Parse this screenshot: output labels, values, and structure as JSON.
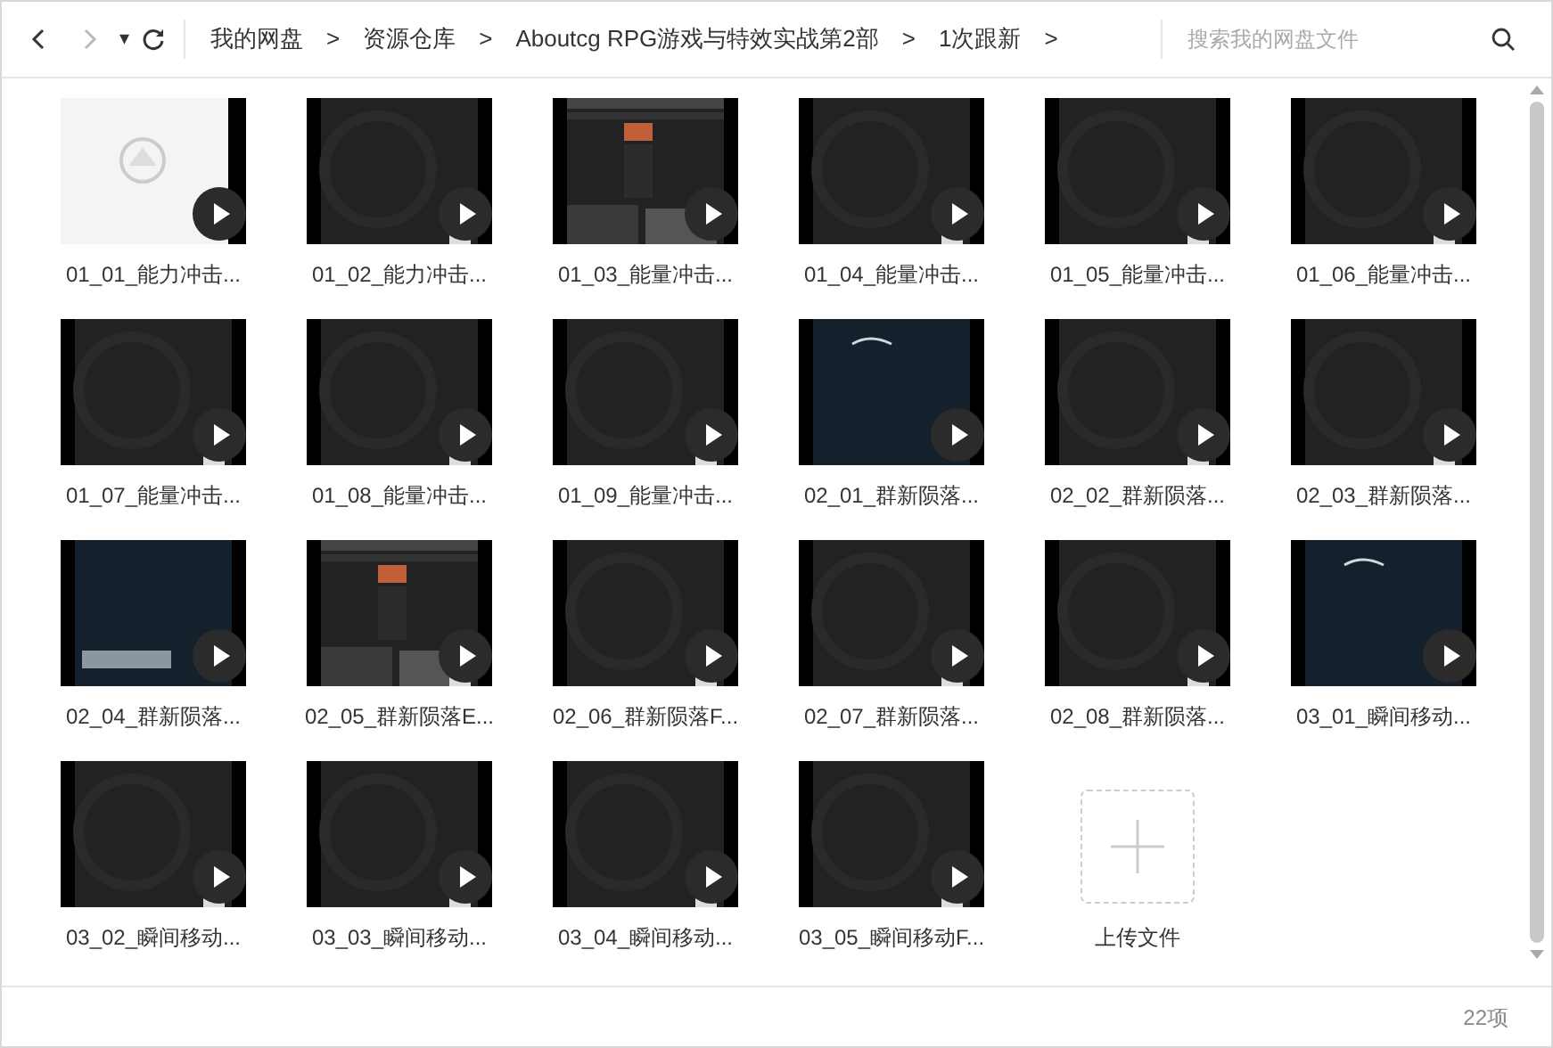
{
  "toolbar": {
    "dropdown": "▾",
    "breadcrumbs": [
      {
        "label": "我的网盘"
      },
      {
        "label": "资源仓库"
      },
      {
        "label": "Aboutcg RPG游戏与特效实战第2部"
      },
      {
        "label": "1次跟新"
      }
    ],
    "separator": ">",
    "search": {
      "placeholder": "搜索我的网盘文件"
    }
  },
  "files": [
    {
      "name": "01_01_能力冲击..."
    },
    {
      "name": "01_02_能力冲击..."
    },
    {
      "name": "01_03_能量冲击..."
    },
    {
      "name": "01_04_能量冲击..."
    },
    {
      "name": "01_05_能量冲击..."
    },
    {
      "name": "01_06_能量冲击..."
    },
    {
      "name": "01_07_能量冲击..."
    },
    {
      "name": "01_08_能量冲击..."
    },
    {
      "name": "01_09_能量冲击..."
    },
    {
      "name": "02_01_群新陨落..."
    },
    {
      "name": "02_02_群新陨落..."
    },
    {
      "name": "02_03_群新陨落..."
    },
    {
      "name": "02_04_群新陨落..."
    },
    {
      "name": "02_05_群新陨落E..."
    },
    {
      "name": "02_06_群新陨落F..."
    },
    {
      "name": "02_07_群新陨落..."
    },
    {
      "name": "02_08_群新陨落..."
    },
    {
      "name": "03_01_瞬间移动..."
    },
    {
      "name": "03_02_瞬间移动..."
    },
    {
      "name": "03_03_瞬间移动..."
    },
    {
      "name": "03_04_瞬间移动..."
    },
    {
      "name": "03_05_瞬间移动F..."
    }
  ],
  "upload": {
    "label": "上传文件"
  },
  "status": {
    "count": "22项"
  }
}
